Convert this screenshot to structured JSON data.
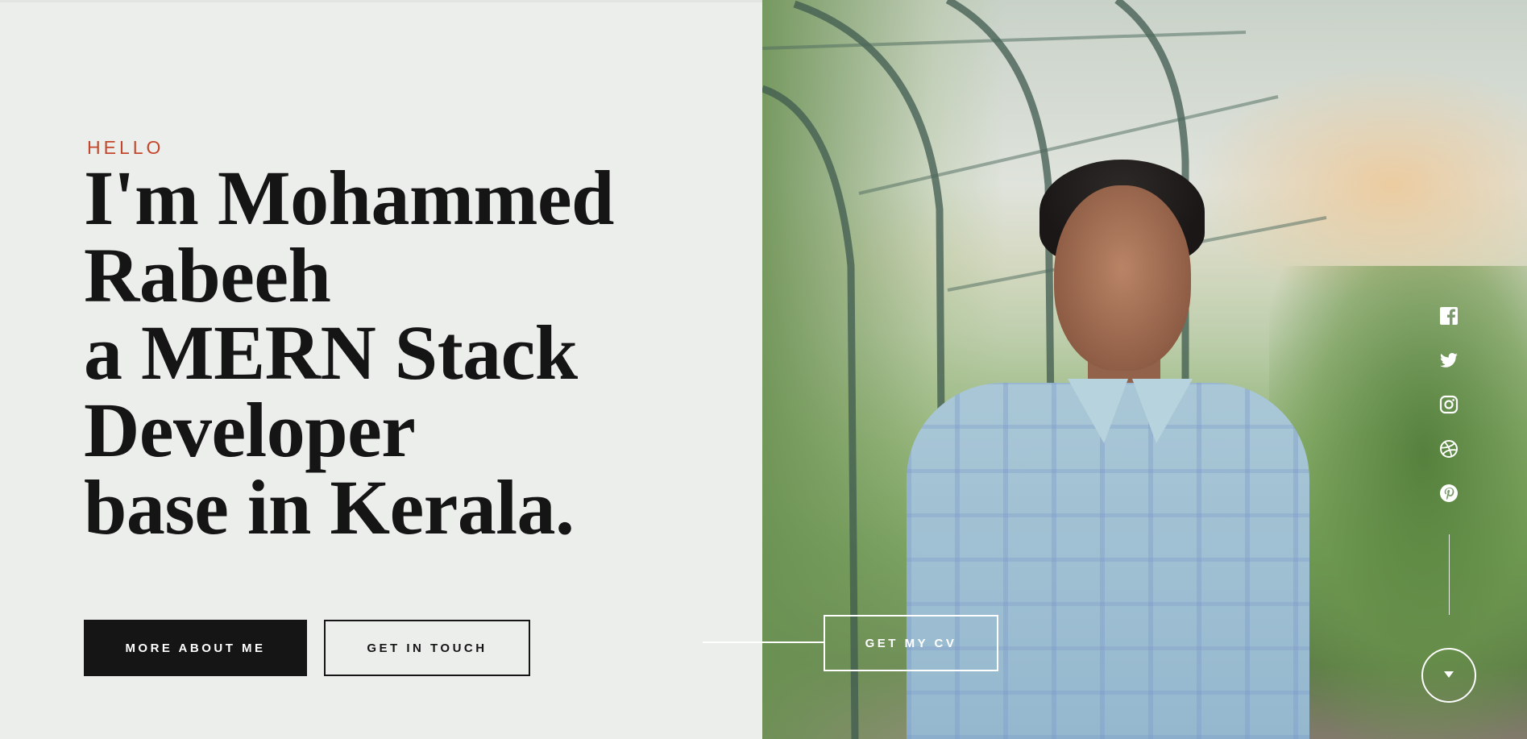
{
  "hero": {
    "eyebrow": "HELLO",
    "headline_lines": [
      "I'm Mohammed",
      "Rabeeh",
      "a MERN Stack",
      "Developer",
      "base in Kerala."
    ]
  },
  "buttons": {
    "more_about": "MORE ABOUT ME",
    "get_in_touch": "GET IN TOUCH",
    "get_cv": "GET MY CV"
  },
  "social": {
    "icons": [
      "facebook-icon",
      "twitter-icon",
      "instagram-icon",
      "dribbble-icon",
      "pinterest-icon"
    ]
  },
  "scroll": {
    "icon": "caret-down-icon"
  },
  "colors": {
    "accent": "#c5472b",
    "text": "#151515",
    "background": "#eceeec",
    "inverse": "#ffffff"
  }
}
